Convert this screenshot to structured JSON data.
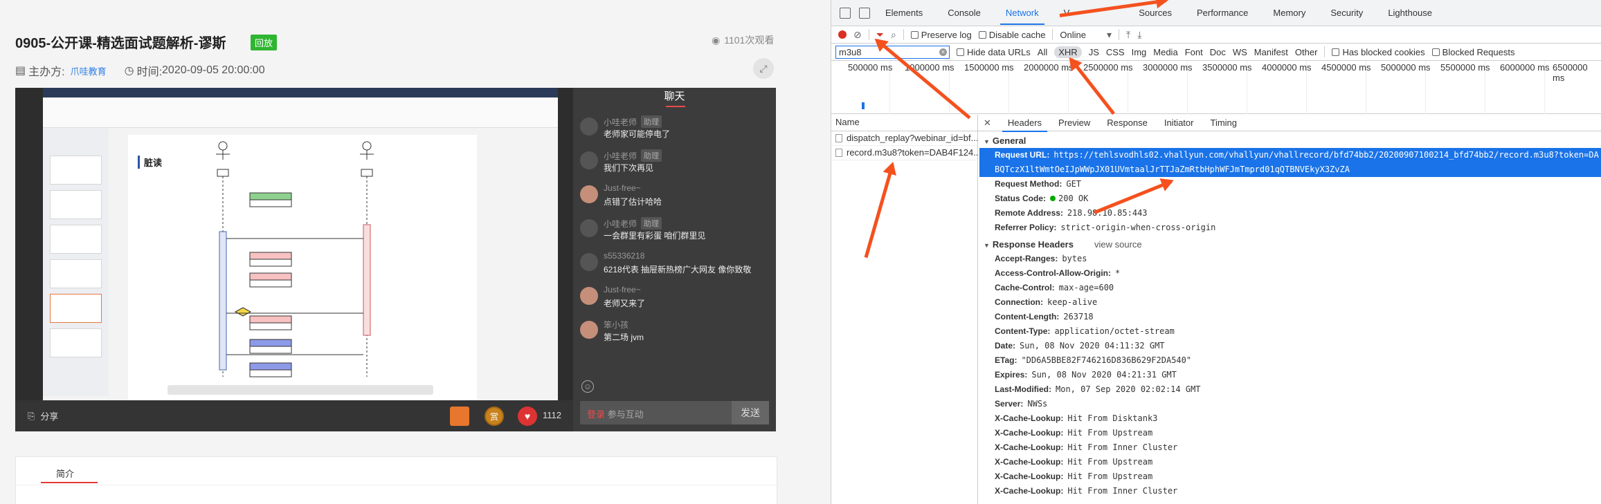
{
  "course": {
    "title": "0905-公开课-精选面试题解析-谬斯",
    "badge": "回放",
    "views": "1101次观看",
    "host_label": "主办方:",
    "host_org": "爪哇教育",
    "time_label": "时间:",
    "time_value": "2020-09-05 20:00:00"
  },
  "slide": {
    "heading": "脏读"
  },
  "player": {
    "share_label": "分享",
    "reward_label": "赏",
    "likes": "1112"
  },
  "chat": {
    "title": "聊天",
    "messages": [
      {
        "name": "小哇老师",
        "tag": "助理",
        "text": "老师家可能停电了"
      },
      {
        "name": "小哇老师",
        "tag": "助理",
        "text": "我们下次再见"
      },
      {
        "name": "Just-free~",
        "tag": "",
        "text": "点错了估计哈哈"
      },
      {
        "name": "小哇老师",
        "tag": "助理",
        "text": "一会群里有彩蛋 咱们群里见"
      },
      {
        "name": "s55336218",
        "tag": "",
        "text": "6218代表 抽屉新热榜广大网友 像你致敬"
      },
      {
        "name": "Just-free~",
        "tag": "",
        "text": "老师又来了"
      },
      {
        "name": "笨小孩",
        "tag": "",
        "text": "第二场 jvm"
      }
    ],
    "login": "登录",
    "input_placeholder": "参与互动",
    "send": "发送"
  },
  "intro_tab": "简介",
  "devtools": {
    "tabs": [
      "Elements",
      "Console",
      "Network",
      "V",
      "Sources",
      "Performance",
      "Memory",
      "Security",
      "Lighthouse"
    ],
    "active_tab": "Network",
    "toolbar": {
      "preserve_log": "Preserve log",
      "disable_cache": "Disable cache",
      "throttle": "Online"
    },
    "filter": {
      "value": "m3u8",
      "hide_data_urls": "Hide data URLs",
      "types": [
        "All",
        "XHR",
        "JS",
        "CSS",
        "Img",
        "Media",
        "Font",
        "Doc",
        "WS",
        "Manifest",
        "Other"
      ],
      "selected_type": "XHR",
      "has_blocked_cookies": "Has blocked cookies",
      "blocked_requests": "Blocked Requests"
    },
    "timeline_labels": [
      "500000 ms",
      "1000000 ms",
      "1500000 ms",
      "2000000 ms",
      "2500000 ms",
      "3000000 ms",
      "3500000 ms",
      "4000000 ms",
      "4500000 ms",
      "5000000 ms",
      "5500000 ms",
      "6000000 ms",
      "6500000 ms"
    ],
    "name_header": "Name",
    "requests": [
      "dispatch_replay?webinar_id=bf...",
      "record.m3u8?token=DAB4F124..."
    ],
    "detail_tabs": [
      "Headers",
      "Preview",
      "Response",
      "Initiator",
      "Timing"
    ],
    "general": {
      "title": "General",
      "request_url_label": "Request URL:",
      "request_url_line1": "https://tehlsvodhls02.vhallyun.com/vhallyun/vhallrecord/bfd74bb2/20200907100214_bfd74bb2/record.m3u8?token=DA",
      "request_url_line2": "BQTczX1ltWmtOeIJpWWpJX01UVmtaalJrTTJaZmRtbHphWFJmTmprd01qQTBNVEkyX3ZvZA",
      "rows": [
        {
          "k": "Request Method:",
          "v": "GET"
        },
        {
          "k": "Status Code:",
          "v": "200 OK"
        },
        {
          "k": "Remote Address:",
          "v": "218.98.10.85:443"
        },
        {
          "k": "Referrer Policy:",
          "v": "strict-origin-when-cross-origin"
        }
      ]
    },
    "response_headers": {
      "title": "Response Headers",
      "view_source": "view source",
      "rows": [
        {
          "k": "Accept-Ranges:",
          "v": "bytes"
        },
        {
          "k": "Access-Control-Allow-Origin:",
          "v": "*"
        },
        {
          "k": "Cache-Control:",
          "v": "max-age=600"
        },
        {
          "k": "Connection:",
          "v": "keep-alive"
        },
        {
          "k": "Content-Length:",
          "v": "263718"
        },
        {
          "k": "Content-Type:",
          "v": "application/octet-stream"
        },
        {
          "k": "Date:",
          "v": "Sun, 08 Nov 2020 04:11:32 GMT"
        },
        {
          "k": "ETag:",
          "v": "\"DD6A5BBE82F746216D836B629F2DA540\""
        },
        {
          "k": "Expires:",
          "v": "Sun, 08 Nov 2020 04:21:31 GMT"
        },
        {
          "k": "Last-Modified:",
          "v": "Mon, 07 Sep 2020 02:02:14 GMT"
        },
        {
          "k": "Server:",
          "v": "NWSs"
        },
        {
          "k": "X-Cache-Lookup:",
          "v": "Hit From Disktank3"
        },
        {
          "k": "X-Cache-Lookup:",
          "v": "Hit From Upstream"
        },
        {
          "k": "X-Cache-Lookup:",
          "v": "Hit From Inner Cluster"
        },
        {
          "k": "X-Cache-Lookup:",
          "v": "Hit From Upstream"
        },
        {
          "k": "X-Cache-Lookup:",
          "v": "Hit From Upstream"
        },
        {
          "k": "X-Cache-Lookup:",
          "v": "Hit From Inner Cluster"
        }
      ]
    }
  }
}
